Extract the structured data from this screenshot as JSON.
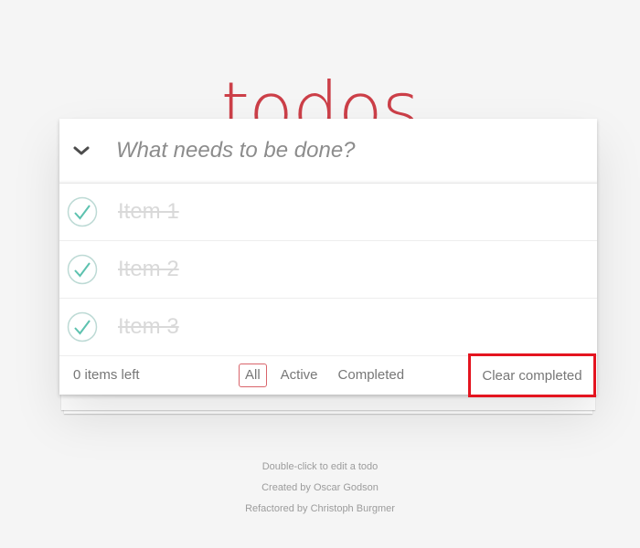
{
  "app": {
    "title": "todos"
  },
  "header": {
    "toggle_all_icon": "chevron-down-icon",
    "new_todo_placeholder": "What needs to be done?",
    "new_todo_value": ""
  },
  "todos": [
    {
      "label": "Item 1",
      "completed": true
    },
    {
      "label": "Item 2",
      "completed": true
    },
    {
      "label": "Item 3",
      "completed": true
    }
  ],
  "footer": {
    "count_text": "0 items left",
    "filters": [
      {
        "label": "All",
        "selected": true
      },
      {
        "label": "Active",
        "selected": false
      },
      {
        "label": "Completed",
        "selected": false
      }
    ],
    "clear_completed": "Clear completed"
  },
  "info": {
    "line1": "Double-click to edit a todo",
    "line2": "Created by Oscar Godson",
    "line3": "Refactored by Christoph Burgmer"
  },
  "colors": {
    "title": "#c9303a",
    "check_ring": "#bddad5",
    "check_mark": "#5dc2af",
    "selected_filter_border": "#d9646b",
    "highlight_box": "#e4141f"
  }
}
